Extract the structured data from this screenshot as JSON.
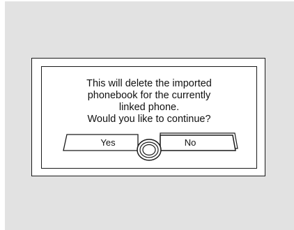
{
  "dialog": {
    "message_lines": [
      "This will delete the imported",
      "phonebook for the currently",
      "linked phone.",
      "Would  you like to continue?"
    ],
    "yes_label": "Yes",
    "no_label": "No",
    "selected": "No"
  },
  "controls": {
    "selector_icon": "interface-dial-icon"
  },
  "colors": {
    "screen_background": "#e2e2e2",
    "dialog_background": "#ffffff",
    "line": "#1a1a1a"
  }
}
